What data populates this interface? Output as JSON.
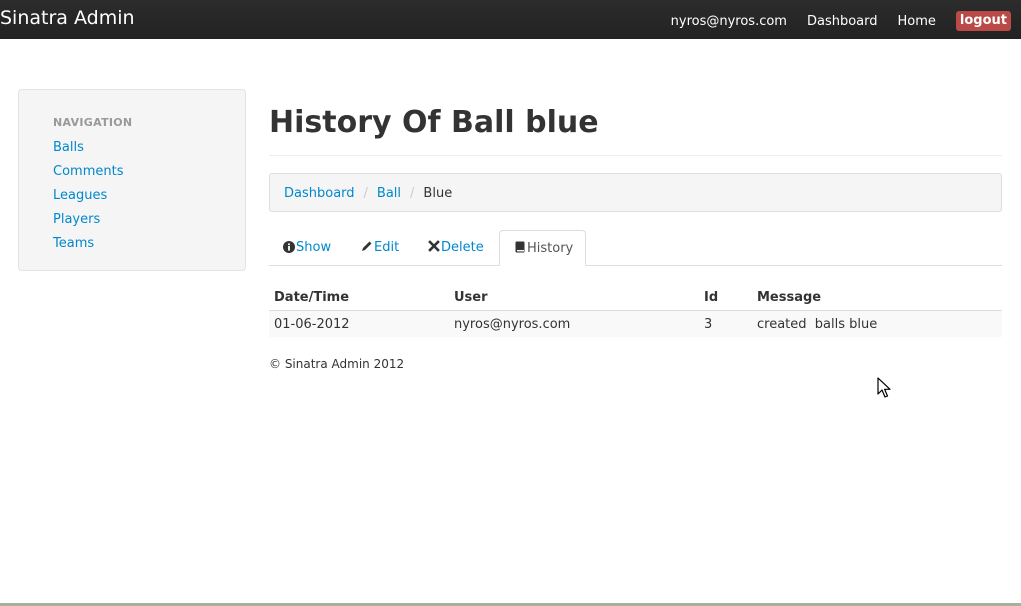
{
  "navbar": {
    "brand": "Sinatra Admin",
    "user_email": "nyros@nyros.com",
    "dashboard_label": "Dashboard",
    "home_label": "Home",
    "logout_label": "logout",
    "logout_color": "#b94a48"
  },
  "sidebar": {
    "header": "NAVIGATION",
    "items": [
      {
        "label": "Balls"
      },
      {
        "label": "Comments"
      },
      {
        "label": "Leagues"
      },
      {
        "label": "Players"
      },
      {
        "label": "Teams"
      }
    ]
  },
  "main": {
    "title": "History Of Ball blue",
    "breadcrumb": {
      "items": [
        "Dashboard",
        "Ball"
      ],
      "current": "Blue",
      "divider": "/"
    },
    "tabs": [
      {
        "label": "Show",
        "icon": "info-icon",
        "active": false
      },
      {
        "label": "Edit",
        "icon": "pencil-icon",
        "active": false
      },
      {
        "label": "Delete",
        "icon": "close-icon",
        "active": false
      },
      {
        "label": "History",
        "icon": "book-icon",
        "active": true
      }
    ],
    "table": {
      "columns": [
        "Date/Time",
        "User",
        "Id",
        "Message"
      ],
      "rows": [
        {
          "datetime": "01-06-2012",
          "user": "nyros@nyros.com",
          "id": "3",
          "message": "created  balls blue"
        }
      ]
    }
  },
  "footer": {
    "text": "© Sinatra Admin 2012"
  },
  "colors": {
    "link": "#0088cc",
    "navbar_bg": "#222222",
    "sidebar_bg": "#f5f5f5"
  }
}
